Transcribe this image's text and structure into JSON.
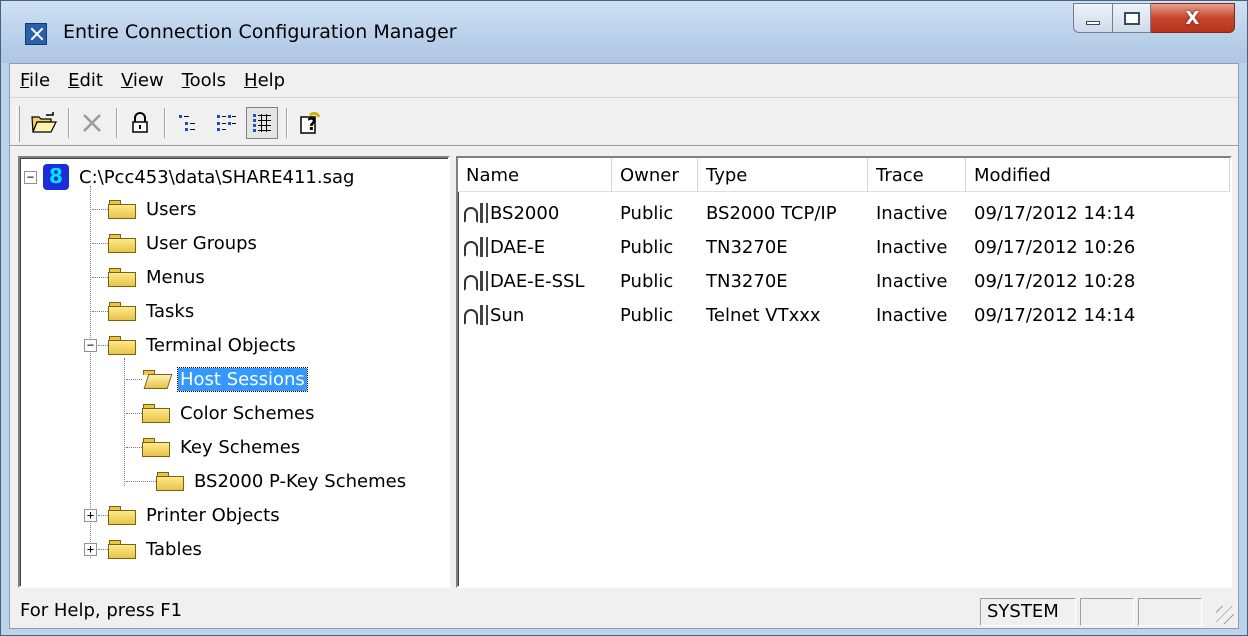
{
  "window": {
    "title": "Entire Connection Configuration Manager",
    "close_glyph": "X"
  },
  "menu": [
    {
      "label": "File",
      "mnemonic": "F"
    },
    {
      "label": "Edit",
      "mnemonic": "E"
    },
    {
      "label": "View",
      "mnemonic": "V"
    },
    {
      "label": "Tools",
      "mnemonic": "T"
    },
    {
      "label": "Help",
      "mnemonic": "H"
    }
  ],
  "toolbar": {
    "icons": [
      "open-folder-icon",
      "delete-icon",
      "lock-icon",
      "list-view-icon",
      "details-view-icon",
      "table-view-icon",
      "help-icon"
    ]
  },
  "tree": {
    "root": {
      "label": "C:\\Pcc453\\data\\SHARE411.sag",
      "expander": "−"
    },
    "items": [
      {
        "label": "Users"
      },
      {
        "label": "User Groups"
      },
      {
        "label": "Menus"
      },
      {
        "label": "Tasks"
      },
      {
        "label": "Terminal Objects",
        "expander": "−"
      },
      {
        "label": "Host Sessions",
        "selected": true
      },
      {
        "label": "Color Schemes"
      },
      {
        "label": "Key Schemes"
      },
      {
        "label": "BS2000 P-Key Schemes"
      },
      {
        "label": "Printer Objects",
        "expander": "+"
      },
      {
        "label": "Tables",
        "expander": "+"
      }
    ]
  },
  "list": {
    "columns": [
      "Name",
      "Owner",
      "Type",
      "Trace",
      "Modified"
    ],
    "rows": [
      {
        "name": "BS2000",
        "owner": "Public",
        "type": "BS2000 TCP/IP",
        "trace": "Inactive",
        "modified": "09/17/2012 14:14"
      },
      {
        "name": "DAE-E",
        "owner": "Public",
        "type": "TN3270E",
        "trace": "Inactive",
        "modified": "09/17/2012 10:26"
      },
      {
        "name": "DAE-E-SSL",
        "owner": "Public",
        "type": "TN3270E",
        "trace": "Inactive",
        "modified": "09/17/2012 10:28"
      },
      {
        "name": "Sun",
        "owner": "Public",
        "type": "Telnet VTxxx",
        "trace": "Inactive",
        "modified": "09/17/2012 14:14"
      }
    ]
  },
  "status": {
    "help_text": "For Help, press F1",
    "user": "SYSTEM",
    "pane2": "",
    "pane3": ""
  },
  "colors": {
    "selection": "#3399ff",
    "folder": "#e8c44a"
  }
}
